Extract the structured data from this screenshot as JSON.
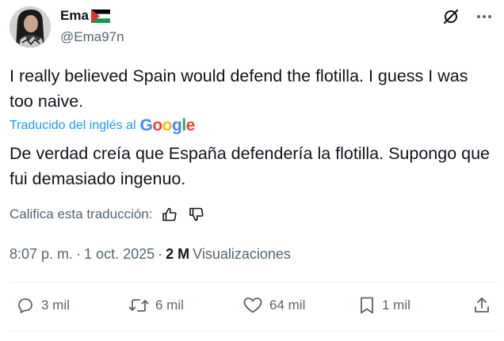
{
  "author": {
    "name": "Ema",
    "handle": "@Ema97n"
  },
  "icons": {
    "avatar": "avatar",
    "flag": "palestine-flag-icon",
    "grok": "grok-icon",
    "more": "more-icon",
    "thumbs_up": "thumbs-up-icon",
    "thumbs_down": "thumbs-down-icon",
    "reply": "reply-icon",
    "repost": "repost-icon",
    "like": "heart-icon",
    "bookmark": "bookmark-icon",
    "share": "share-icon"
  },
  "post": {
    "text_original": "I really believed Spain would defend the flotilla. I guess I was too naive.",
    "translated_label": "Traducido del inglés al",
    "translator": "Google",
    "text_translated": "De verdad creía que España defendería la flotilla. Supongo que fui demasiado ingenuo.",
    "rate_label": "Califica esta traducción:"
  },
  "meta": {
    "time": "8:07 p. m.",
    "separator": "·",
    "date": "1 oct. 2025",
    "views_separator": "·",
    "views_count": "2 M",
    "views_label": "Visualizaciones"
  },
  "actions": {
    "replies": "3 mil",
    "reposts": "6 mil",
    "likes": "64 mil",
    "bookmarks": "1 mil"
  },
  "colors": {
    "text": "#0f1419",
    "secondary": "#536471",
    "link": "#1d9bf0",
    "divider": "#eff3f4"
  }
}
